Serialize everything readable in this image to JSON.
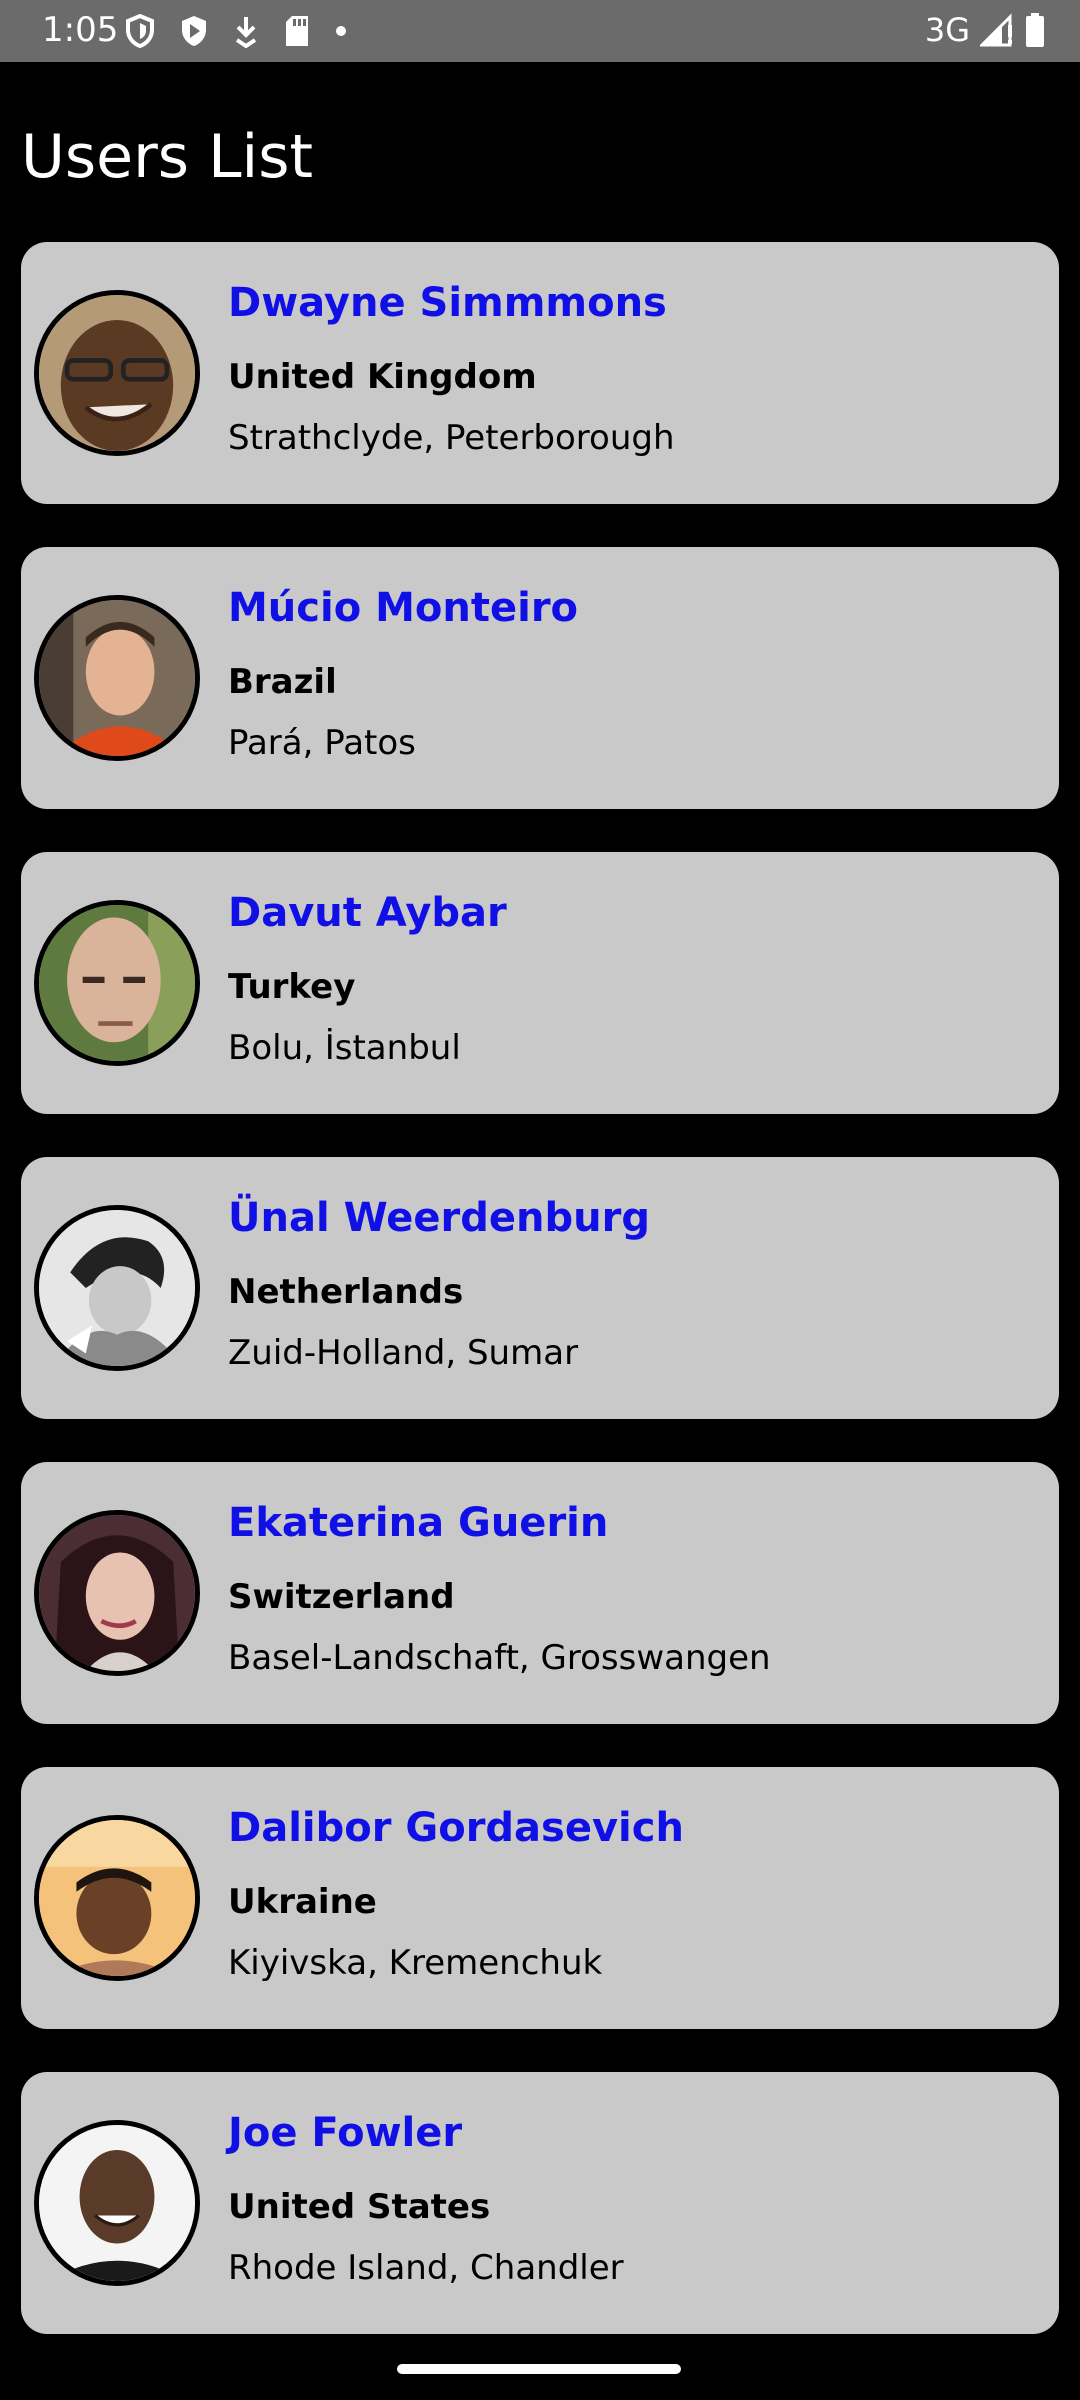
{
  "status_bar": {
    "time": "1:05",
    "network": "3G",
    "left_icons": [
      "shield-icon",
      "play-store-icon",
      "download-icon",
      "sd-card-icon",
      "dot-icon"
    ],
    "right_icons": [
      "signal-icon",
      "battery-icon"
    ]
  },
  "header": {
    "title": "Users List"
  },
  "colors": {
    "background": "#000000",
    "card": "#c9c9c9",
    "name": "#1010e6",
    "status_bar": "#6b6b6b"
  },
  "users": [
    {
      "name": "Dwayne Simmmons",
      "country": "United Kingdom",
      "location": "Strathclyde, Peterborough"
    },
    {
      "name": "Múcio Monteiro",
      "country": "Brazil",
      "location": "Pará, Patos"
    },
    {
      "name": "Davut Aybar",
      "country": "Turkey",
      "location": "Bolu, İstanbul"
    },
    {
      "name": "Ünal Weerdenburg",
      "country": "Netherlands",
      "location": "Zuid-Holland, Sumar"
    },
    {
      "name": "Ekaterina Guerin",
      "country": "Switzerland",
      "location": "Basel-Landschaft, Grosswangen"
    },
    {
      "name": "Dalibor Gordasevich",
      "country": "Ukraine",
      "location": "Kiyivska, Kremenchuk"
    },
    {
      "name": "Joe Fowler",
      "country": "United States",
      "location": "Rhode Island, Chandler"
    }
  ]
}
